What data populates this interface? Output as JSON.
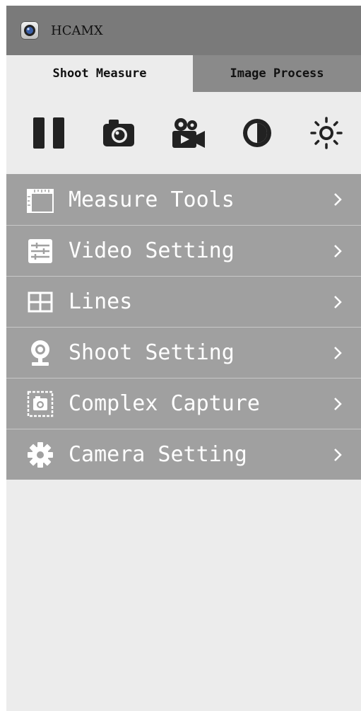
{
  "app": {
    "title": "HCAMX"
  },
  "tabs": [
    {
      "label": "Shoot Measure",
      "active": true
    },
    {
      "label": "Image Process",
      "active": false
    }
  ],
  "toolbar": [
    {
      "icon": "pause-icon"
    },
    {
      "icon": "camera-icon"
    },
    {
      "icon": "video-record-icon"
    },
    {
      "icon": "contrast-icon"
    },
    {
      "icon": "brightness-icon"
    }
  ],
  "menu": [
    {
      "label": "Measure Tools",
      "icon": "ruler-icon"
    },
    {
      "label": "Video Setting",
      "icon": "sliders-icon"
    },
    {
      "label": "Lines",
      "icon": "grid-icon"
    },
    {
      "label": "Shoot Setting",
      "icon": "webcam-icon"
    },
    {
      "label": "Complex Capture",
      "icon": "capture-frame-icon"
    },
    {
      "label": "Camera Setting",
      "icon": "gear-icon"
    }
  ],
  "colors": {
    "titlebar": "#7a7a7a",
    "menu_bg": "#a0a0a0",
    "panel_bg": "#ececec"
  }
}
